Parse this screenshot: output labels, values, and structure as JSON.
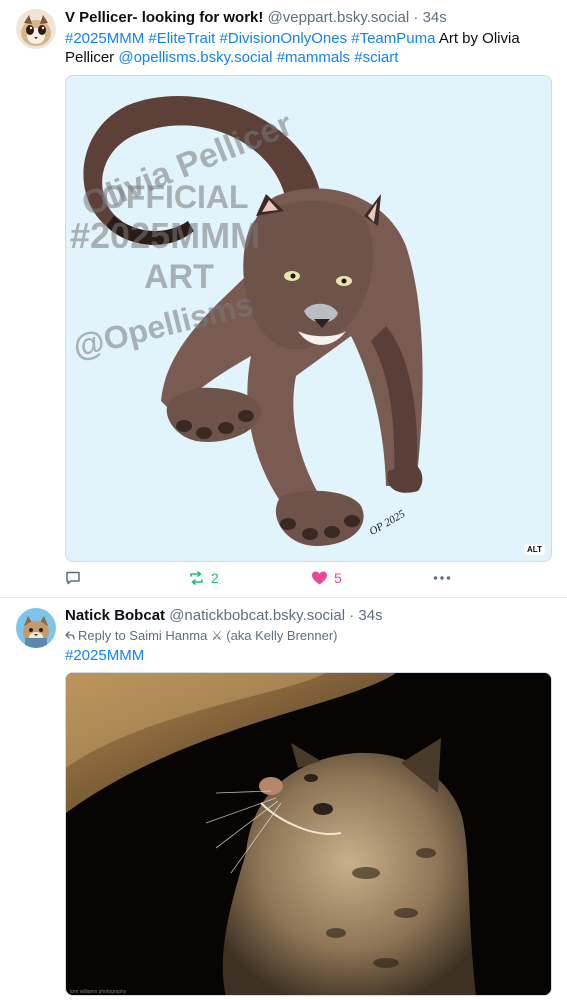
{
  "colors": {
    "link": "#1083fe",
    "muted": "#5f6e7e",
    "repost": "#13c27a",
    "like": "#ec4899"
  },
  "post1": {
    "author_name": "V Pellicer- looking for work!",
    "handle": "@veppart.bsky.social",
    "separator": "·",
    "time": "34s",
    "tags": [
      "#2025MMM",
      "#EliteTrait",
      "#DivisionOnlyOnes",
      "#TeamPuma"
    ],
    "text_plain_1": "Art by Olivia",
    "text_plain_2": "Pellicer",
    "mention": "@opellisms.bsky.social",
    "tags2": [
      "#mammals",
      "#sciart"
    ],
    "watermark": [
      "Olivia Pellicer",
      "OFFICIAL",
      "#2025MMM",
      "ART",
      "@Opellisms"
    ],
    "signature": "OP 2025",
    "alt_label": "ALT",
    "repost_count": "2",
    "like_count": "5",
    "icons": {
      "reply": "reply-icon",
      "repost": "repost-icon",
      "like": "heart-icon",
      "more": "more-icon"
    }
  },
  "post2": {
    "author_name": "Natick Bobcat",
    "handle": "@natickbobcat.bsky.social",
    "separator": "·",
    "time": "34s",
    "reply_prefix": "Reply to Saimi Hanma",
    "reply_emoji": "⚔",
    "reply_suffix": "(aka Kelly Brenner)",
    "tags": [
      "#2025MMM"
    ],
    "photo_credit": "tom williams photography"
  }
}
